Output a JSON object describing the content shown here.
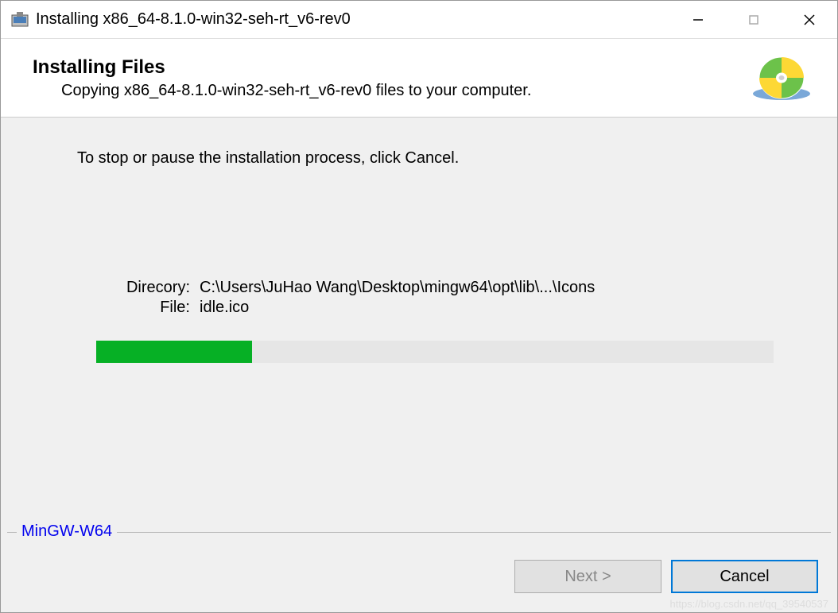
{
  "window": {
    "title": "Installing x86_64-8.1.0-win32-seh-rt_v6-rev0"
  },
  "header": {
    "title": "Installing Files",
    "subtitle": "Copying x86_64-8.1.0-win32-seh-rt_v6-rev0 files to your computer."
  },
  "main": {
    "instruction": "To stop or pause the installation process, click Cancel.",
    "directory_label": "Direcory:",
    "directory_value": "C:\\Users\\JuHao Wang\\Desktop\\mingw64\\opt\\lib\\...\\Icons",
    "file_label": "File:",
    "file_value": "idle.ico",
    "progress_percent": 23
  },
  "branding": "MinGW-W64",
  "buttons": {
    "next": "Next >",
    "cancel": "Cancel"
  },
  "watermark": "https://blog.csdn.net/qq_39540537"
}
